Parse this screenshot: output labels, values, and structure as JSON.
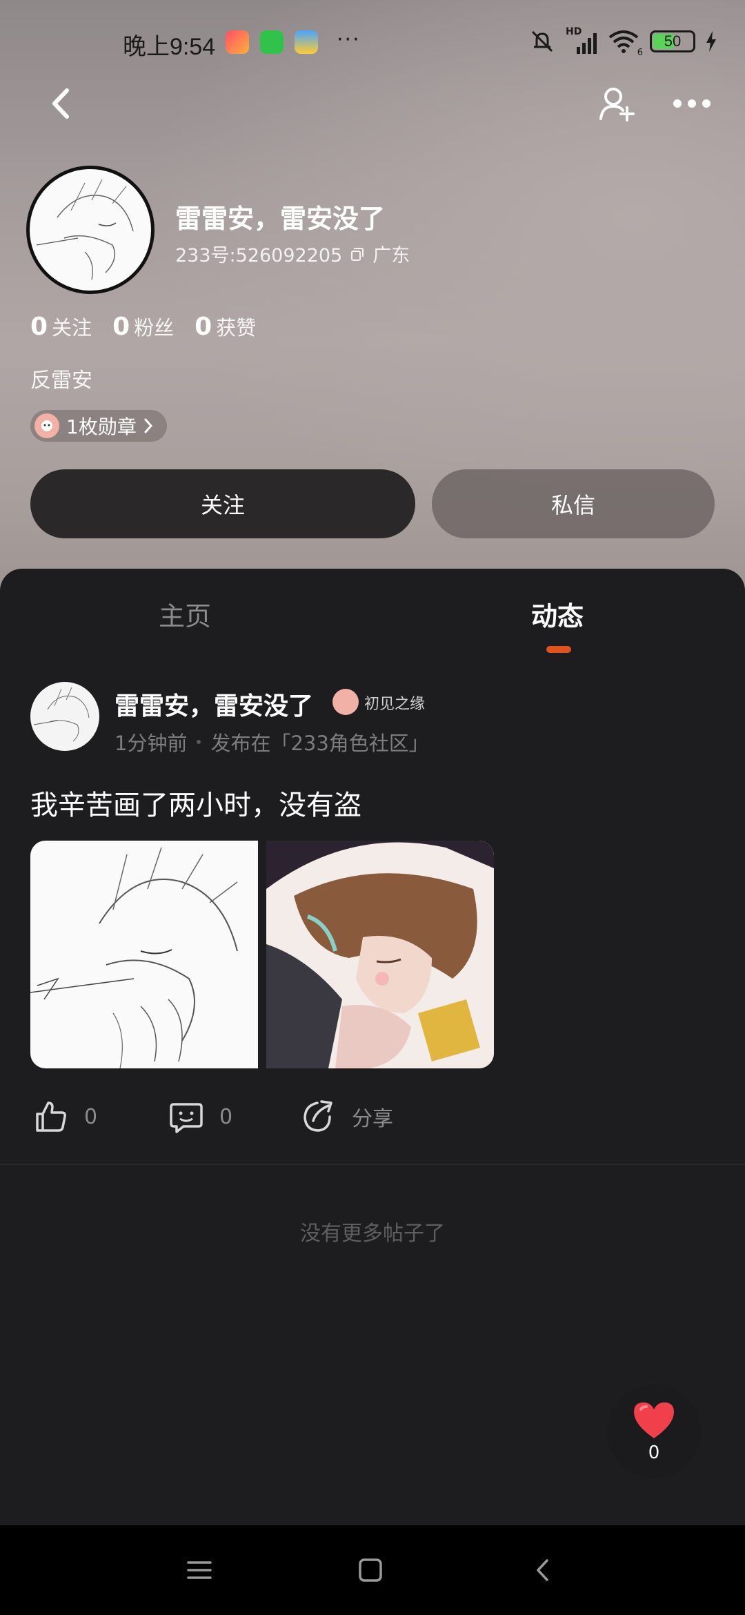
{
  "status_bar": {
    "time": "晚上9:54",
    "overflow": "···",
    "battery": "50",
    "signal_label": "HD",
    "wifi_label": "6"
  },
  "profile": {
    "name": "雷雷安，雷安没了",
    "uid": "233号:526092205",
    "location": "广东",
    "stats": [
      {
        "num": "0",
        "label": "关注"
      },
      {
        "num": "0",
        "label": "粉丝"
      },
      {
        "num": "0",
        "label": "获赞"
      }
    ],
    "bio": "反雷安",
    "medal": "1枚勋章",
    "follow_label": "关注",
    "message_label": "私信"
  },
  "tabs": [
    {
      "label": "主页",
      "active": false
    },
    {
      "label": "动态",
      "active": true
    }
  ],
  "post": {
    "author": "雷雷安，雷安没了",
    "badge": "初见之缘",
    "time_ago": "1分钟前",
    "community": "发布在「233角色社区」",
    "text": "我辛苦画了两小时，没有盗",
    "likes": "0",
    "comments": "0",
    "share_label": "分享"
  },
  "feed_end": "没有更多帖子了",
  "like_fab": {
    "count": "0"
  },
  "colors": {
    "accent": "#e0531f",
    "panel_bg": "#1d1c1e",
    "heart": "#f0404b"
  }
}
